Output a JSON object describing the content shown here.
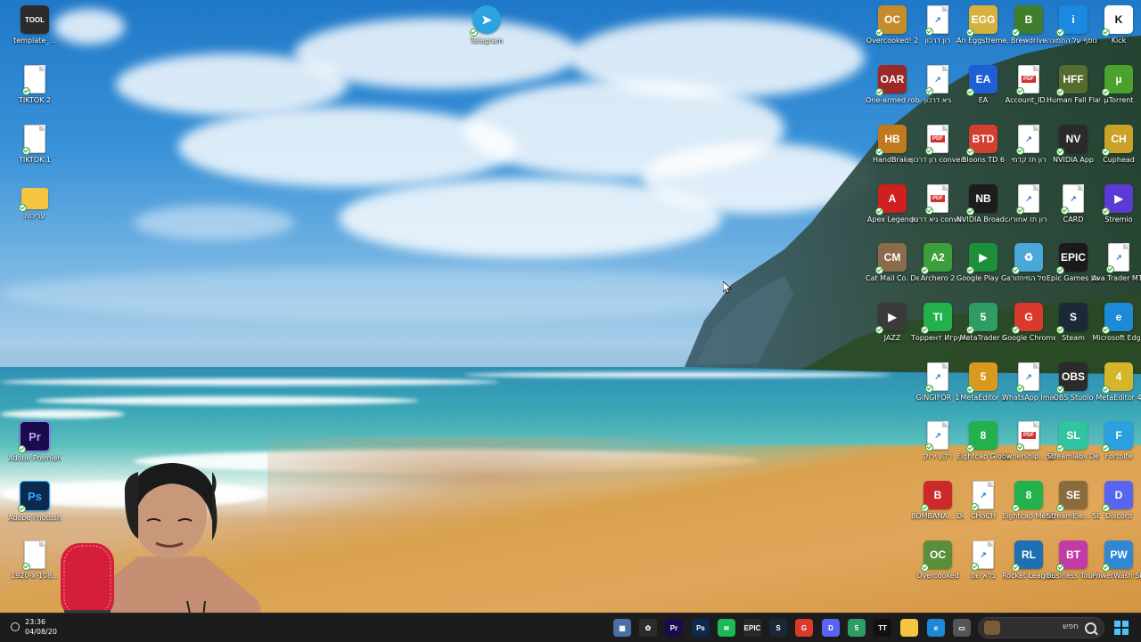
{
  "desktop": {
    "left_icons": [
      {
        "label": "template_...",
        "type": "app",
        "text": "TOOL",
        "color": "#2b2b2b"
      },
      {
        "label": "TIKTOK 2",
        "type": "file"
      },
      {
        "label": "TIKTOK 1",
        "type": "file"
      },
      {
        "label": "עריכות",
        "type": "folder"
      },
      {
        "label": "Adobe Premiere P...",
        "type": "app",
        "text": "Pr",
        "color": "#1b0b4d"
      },
      {
        "label": "Adobe Photosh...",
        "type": "app",
        "text": "Ps",
        "color": "#0a2a4f"
      },
      {
        "label": "1920-x-108...",
        "type": "file"
      }
    ],
    "telegram": {
      "label": "Telegram"
    },
    "grid": [
      [
        {
          "label": "Overcooked! 2",
          "type": "app",
          "text": "OC",
          "color": "#c68b2b"
        },
        {
          "label": "רון דרכון",
          "type": "file"
        },
        {
          "label": "An Eggstreme...",
          "type": "app",
          "text": "EGG",
          "color": "#d6b23c"
        },
        {
          "label": "Brewdrive",
          "type": "app",
          "text": "B",
          "color": "#3e7d2c"
        },
        {
          "label": "מידע נוסף על התמונה",
          "type": "app",
          "text": "i",
          "color": "#1a8ae0"
        },
        {
          "label": "Kick",
          "type": "app",
          "text": "K",
          "color": "#ffffff"
        }
      ],
      [
        {
          "label": "One-armed robber",
          "type": "app",
          "text": "OAR",
          "color": "#9c2828"
        },
        {
          "label": "גיא דרכון",
          "type": "file"
        },
        {
          "label": "EA",
          "type": "app",
          "text": "EA",
          "color": "#1f5fd6"
        },
        {
          "label": "Account_ID...",
          "type": "pdf"
        },
        {
          "label": "Human Fall Flat",
          "type": "app",
          "text": "HFF",
          "color": "#556b2f"
        },
        {
          "label": "µTorrent",
          "type": "app",
          "text": "µ",
          "color": "#4aa22d"
        }
      ],
      [
        {
          "label": "HandBrake",
          "type": "app",
          "text": "HB",
          "color": "#c07a1e"
        },
        {
          "label": "רון דרכון converted...",
          "type": "pdf"
        },
        {
          "label": "Bloons TD 6",
          "type": "app",
          "text": "BTD",
          "color": "#d23f2f"
        },
        {
          "label": "רון תז קדמי",
          "type": "file"
        },
        {
          "label": "NVIDIA App",
          "type": "app",
          "text": "NV",
          "color": "#2a2a2a"
        },
        {
          "label": "Cuphead",
          "type": "app",
          "text": "CH",
          "color": "#c9a227"
        }
      ],
      [
        {
          "label": "Apex Legends",
          "type": "app",
          "text": "A",
          "color": "#cf1f1f"
        },
        {
          "label": "גיא דרכון converted...",
          "type": "pdf"
        },
        {
          "label": "NVIDIA Broadcast",
          "type": "app",
          "text": "NB",
          "color": "#1d1d1d"
        },
        {
          "label": "רון תז אחורי",
          "type": "file"
        },
        {
          "label": "CARD",
          "type": "file"
        },
        {
          "label": "Stremio",
          "type": "app",
          "text": "▶",
          "color": "#5b3bd4"
        }
      ],
      [
        {
          "label": "Cat Mail Co. Demo",
          "type": "app",
          "text": "CM",
          "color": "#8a6b4c"
        },
        {
          "label": "Archero 2",
          "type": "app",
          "text": "A2",
          "color": "#3ba03b"
        },
        {
          "label": "Google Play Games",
          "type": "app",
          "text": "▶",
          "color": "#1d8f3a"
        },
        {
          "label": "סל המיחזור",
          "type": "app",
          "text": "♻",
          "color": "#4aa8d8"
        },
        {
          "label": "Epic Games Launcher",
          "type": "app",
          "text": "EPIC",
          "color": "#1a1a1a"
        },
        {
          "label": "Ava Trader MT4 Ter...",
          "type": "file"
        }
      ],
      [
        {
          "label": "JAZZ",
          "type": "app",
          "text": "▶",
          "color": "#3a3a3a"
        },
        {
          "label": "Торрент Игруха",
          "type": "app",
          "text": "TI",
          "color": "#22b24c"
        },
        {
          "label": "MetaTrader 5",
          "type": "app",
          "text": "5",
          "color": "#2f9d63"
        },
        {
          "label": "Google Chrome",
          "type": "app",
          "text": "G",
          "color": "#d93a2b"
        },
        {
          "label": "Steam",
          "type": "app",
          "text": "S",
          "color": "#1b2838"
        },
        {
          "label": "Microsoft Edge",
          "type": "app",
          "text": "e",
          "color": "#1c8ad6"
        }
      ],
      [
        {
          "label": "",
          "type": "empty"
        },
        {
          "label": "GINGIFOR_1",
          "type": "file"
        },
        {
          "label": "MetaEditor 5",
          "type": "app",
          "text": "5",
          "color": "#d89a1e"
        },
        {
          "label": "WhatsApp Image 2026...",
          "type": "file"
        },
        {
          "label": "OBS Studio",
          "type": "app",
          "text": "OBS",
          "color": "#2b2b2b"
        },
        {
          "label": "MetaEditor 4",
          "type": "app",
          "text": "4",
          "color": "#d7b52a"
        }
      ],
      [
        {
          "label": "",
          "type": "empty"
        },
        {
          "label": "רקע ירוק",
          "type": "file"
        },
        {
          "label": "Eightcap Global M...",
          "type": "app",
          "text": "8",
          "color": "#23b14d"
        },
        {
          "label": "ownership... BANK",
          "type": "pdf"
        },
        {
          "label": "Streamlabs Desktop",
          "type": "app",
          "text": "SL",
          "color": "#2fc5a0"
        },
        {
          "label": "Fortnite",
          "type": "app",
          "text": "F",
          "color": "#2aa0e0"
        }
      ],
      [
        {
          "label": "",
          "type": "empty"
        },
        {
          "label": "BOMBANA... Demo",
          "type": "app",
          "text": "B",
          "color": "#cc2a2a"
        },
        {
          "label": "CHoCH",
          "type": "file"
        },
        {
          "label": "Eightcap MetaTrader 4",
          "type": "app",
          "text": "8",
          "color": "#23b14d"
        },
        {
          "label": "StreamEle... SE.Live",
          "type": "app",
          "text": "SE",
          "color": "#8b6a3e"
        },
        {
          "label": "Discord",
          "type": "app",
          "text": "D",
          "color": "#5865f2"
        }
      ],
      [
        {
          "label": "",
          "type": "empty"
        },
        {
          "label": "Overcooked",
          "type": "app",
          "text": "OC",
          "color": "#5a8e3a"
        },
        {
          "label": "בלא שם",
          "type": "file"
        },
        {
          "label": "Rocket League®",
          "type": "app",
          "text": "RL",
          "color": "#1f6fb4"
        },
        {
          "label": "Business Tour - Online M...",
          "type": "app",
          "text": "BT",
          "color": "#c33ba6"
        },
        {
          "label": "PowerWash Simulator 2",
          "type": "app",
          "text": "PW",
          "color": "#2f87d6"
        }
      ]
    ]
  },
  "taskbar": {
    "time": "23:36",
    "date": "04/08/20",
    "search_label": "חפש",
    "apps": [
      {
        "name": "calculator-icon",
        "text": "▦",
        "color": "#4a6fa5"
      },
      {
        "name": "gallery-icon",
        "text": "✿",
        "color": "#2b2b2b"
      },
      {
        "name": "premiere-icon",
        "text": "Pr",
        "color": "#1b0b4d"
      },
      {
        "name": "photoshop-icon",
        "text": "Ps",
        "color": "#0a2a4f"
      },
      {
        "name": "spotify-icon",
        "text": "≋",
        "color": "#1db954"
      },
      {
        "name": "epic-icon",
        "text": "EPIC",
        "color": "#2a2a2a"
      },
      {
        "name": "steam-icon",
        "text": "S",
        "color": "#1b2838"
      },
      {
        "name": "chrome-icon",
        "text": "G",
        "color": "#d93a2b"
      },
      {
        "name": "discord-icon",
        "text": "D",
        "color": "#5865f2"
      },
      {
        "name": "metatrader-icon",
        "text": "5",
        "color": "#2f9d63"
      },
      {
        "name": "tiktok-icon",
        "text": "TT",
        "color": "#111"
      },
      {
        "name": "folder-icon",
        "text": "",
        "color": "#f5c542"
      },
      {
        "name": "edge-icon",
        "text": "e",
        "color": "#1c8ad6"
      },
      {
        "name": "window-icon",
        "text": "▭",
        "color": "#555"
      }
    ]
  }
}
